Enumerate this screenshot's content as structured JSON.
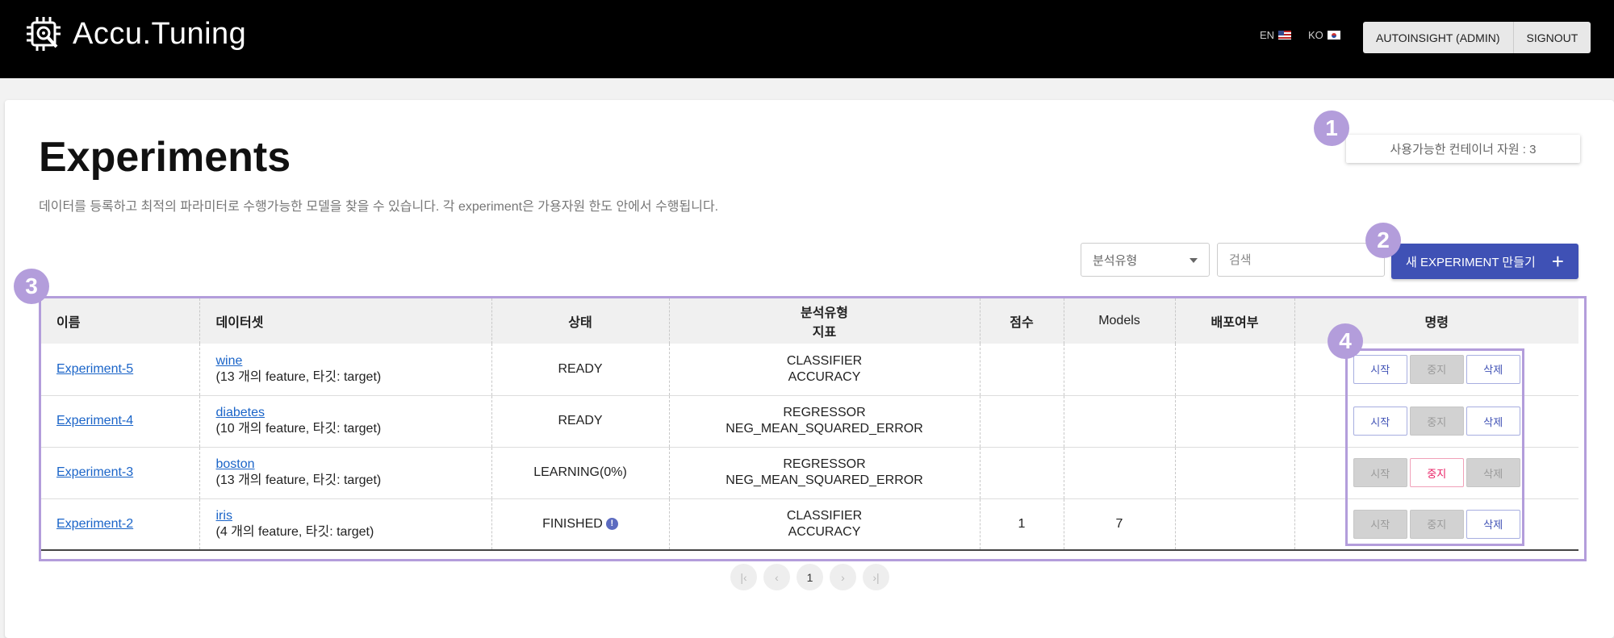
{
  "header": {
    "app_name": "Accu.Tuning",
    "lang_en": "EN",
    "lang_ko": "KO",
    "user_button": "AUTOINSIGHT (ADMIN)",
    "signout_button": "SIGNOUT"
  },
  "page": {
    "title": "Experiments",
    "subtitle": "데이터를 등록하고 최적의 파라미터로 수행가능한 모델을 찾을 수 있습니다. 각 experiment은 가용자원 한도 안에서 수행됩니다.",
    "resource_label": "사용가능한 컨테이너 자원 : 3"
  },
  "toolbar": {
    "filter_placeholder": "분석유형",
    "search_placeholder": "검색",
    "new_experiment_button": "새 EXPERIMENT 만들기"
  },
  "table": {
    "headers": {
      "name": "이름",
      "dataset": "데이터셋",
      "status": "상태",
      "analysis_type": "분석유형",
      "metric": "지표",
      "score": "점수",
      "models": "Models",
      "deployed": "배포여부",
      "commands": "명령"
    },
    "rows": [
      {
        "name": "Experiment-5",
        "dataset": "wine",
        "dataset_desc": "(13 개의 feature, 타깃: target)",
        "status": "READY",
        "analysis_type": "CLASSIFIER",
        "metric": "ACCURACY",
        "score": "",
        "models": "",
        "deployed": "",
        "cmd_start": "시작",
        "cmd_stop": "중지",
        "cmd_delete": "삭제"
      },
      {
        "name": "Experiment-4",
        "dataset": "diabetes",
        "dataset_desc": "(10 개의 feature, 타깃: target)",
        "status": "READY",
        "analysis_type": "REGRESSOR",
        "metric": "NEG_MEAN_SQUARED_ERROR",
        "score": "",
        "models": "",
        "deployed": "",
        "cmd_start": "시작",
        "cmd_stop": "중지",
        "cmd_delete": "삭제"
      },
      {
        "name": "Experiment-3",
        "dataset": "boston",
        "dataset_desc": "(13 개의 feature, 타깃: target)",
        "status": "LEARNING(0%)",
        "analysis_type": "REGRESSOR",
        "metric": "NEG_MEAN_SQUARED_ERROR",
        "score": "",
        "models": "",
        "deployed": "",
        "cmd_start": "시작",
        "cmd_stop": "중지",
        "cmd_delete": "삭제"
      },
      {
        "name": "Experiment-2",
        "dataset": "iris",
        "dataset_desc": "(4 개의 feature, 타깃: target)",
        "status": "FINISHED",
        "analysis_type": "CLASSIFIER",
        "metric": "ACCURACY",
        "score": "1",
        "models": "7",
        "deployed": "",
        "cmd_start": "시작",
        "cmd_stop": "중지",
        "cmd_delete": "삭제"
      }
    ]
  },
  "pagination": {
    "current_page": "1"
  },
  "annotations": {
    "badge_1": "1",
    "badge_2": "2",
    "badge_3": "3",
    "badge_4": "4",
    "color": "#b39ddb"
  },
  "colors": {
    "accent": "#3f51b5",
    "link": "#1a64c8",
    "stop_active": "#e91e63"
  }
}
